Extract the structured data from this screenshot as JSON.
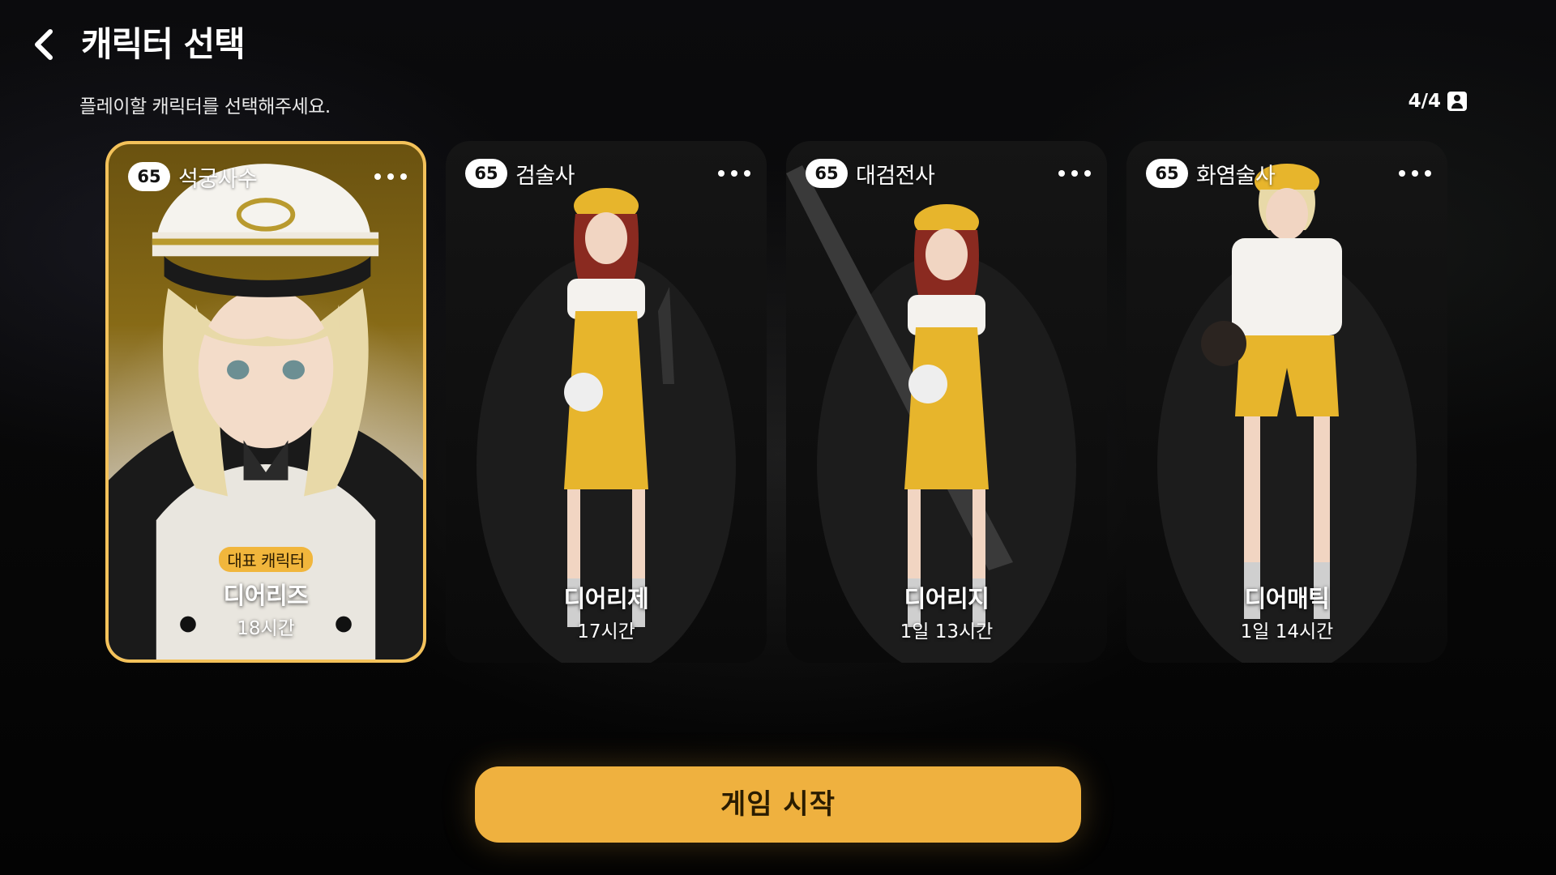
{
  "header": {
    "title": "캐릭터 선택",
    "back_icon": "chevron-left-icon",
    "subtitle": "플레이할 캐릭터를 선택해주세요.",
    "slot_count": "4/4",
    "slot_icon": "person-icon"
  },
  "cards": [
    {
      "level": "65",
      "class": "석궁사수",
      "representative_label": "대표 캐릭터",
      "name": "디어리즈",
      "play_time": "18시간",
      "selected": true,
      "more_icon": "more-horizontal-icon"
    },
    {
      "level": "65",
      "class": "검술사",
      "name": "디어리제",
      "play_time": "17시간",
      "selected": false,
      "more_icon": "more-horizontal-icon"
    },
    {
      "level": "65",
      "class": "대검전사",
      "name": "디어리지",
      "play_time": "1일 13시간",
      "selected": false,
      "more_icon": "more-horizontal-icon"
    },
    {
      "level": "65",
      "class": "화염술사",
      "name": "디어매틱",
      "play_time": "1일 14시간",
      "selected": false,
      "more_icon": "more-horizontal-icon"
    }
  ],
  "start_button": {
    "label": "게임 시작"
  },
  "colors": {
    "accent": "#efb13f",
    "selected_border": "#f4c25a",
    "background": "#050505"
  }
}
